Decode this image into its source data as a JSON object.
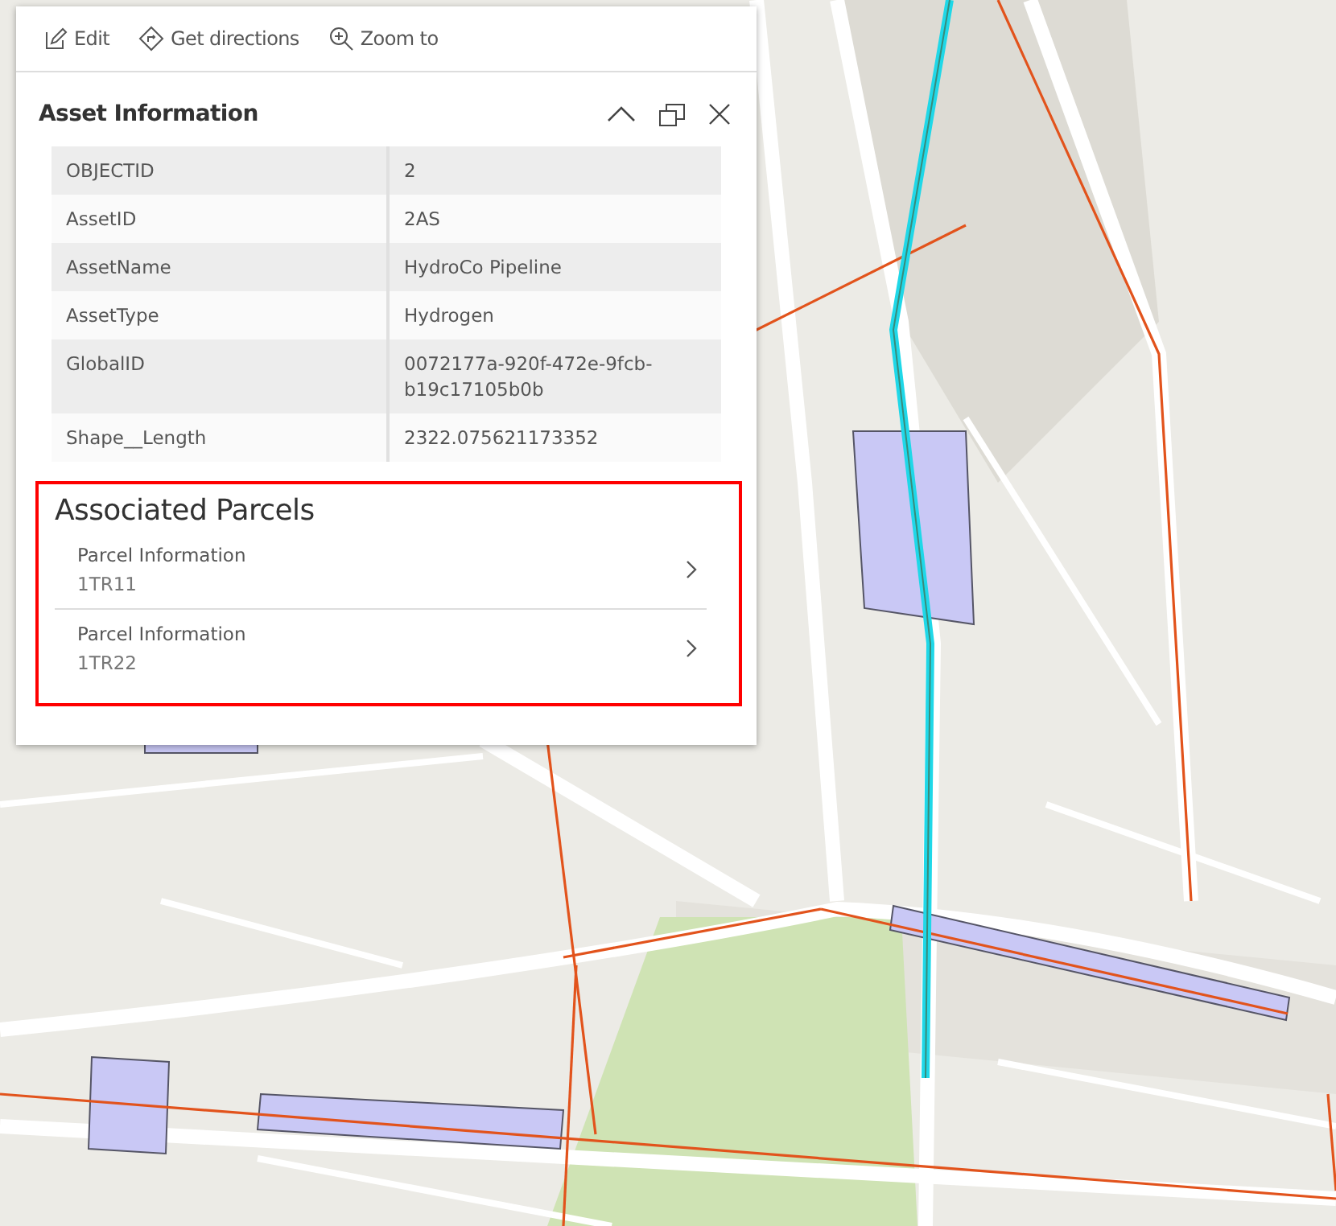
{
  "toolbar": [
    {
      "kind": "edit",
      "label": "Edit"
    },
    {
      "kind": "directions",
      "label": "Get directions"
    },
    {
      "kind": "zoom",
      "label": "Zoom to"
    }
  ],
  "popup": {
    "title": "Asset Information"
  },
  "attributes": [
    {
      "field": "OBJECTID",
      "value": "2"
    },
    {
      "field": "AssetID",
      "value": "2AS"
    },
    {
      "field": "AssetName",
      "value": "HydroCo Pipeline"
    },
    {
      "field": "AssetType",
      "value": "Hydrogen"
    },
    {
      "field": "GlobalID",
      "value": "0072177a-920f-472e-9fcb-b19c17105b0b"
    },
    {
      "field": "Shape__Length",
      "value": "2322.075621173352"
    }
  ],
  "related": {
    "title": "Associated Parcels",
    "items": [
      {
        "label": "Parcel Information",
        "value": "1TR11"
      },
      {
        "label": "Parcel Information",
        "value": "1TR22"
      }
    ]
  }
}
